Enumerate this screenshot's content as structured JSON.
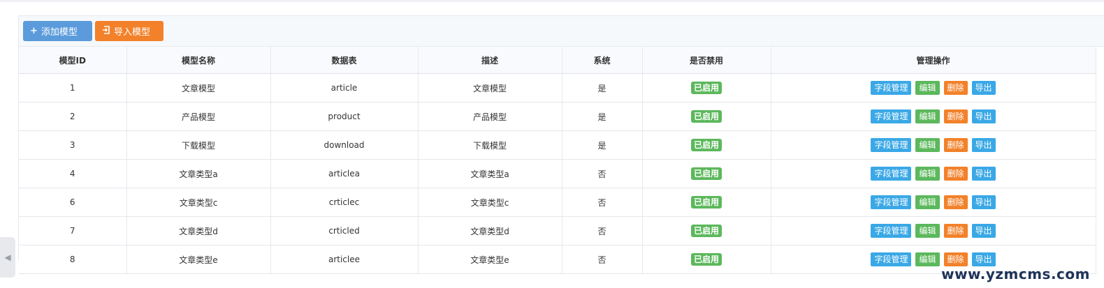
{
  "toolbar": {
    "add_label": "添加模型",
    "add_icon": "plus-icon",
    "import_label": "导入模型",
    "import_icon": "import-icon",
    "add_color": "#5b9bdc",
    "import_color": "#f2812a"
  },
  "table": {
    "headers": [
      "模型ID",
      "模型名称",
      "数据表",
      "描述",
      "系统",
      "是否禁用",
      "管理操作"
    ],
    "rows": [
      {
        "id": "1",
        "name": "文章模型",
        "table": "article",
        "desc": "文章模型",
        "system": "是",
        "status": "已启用"
      },
      {
        "id": "2",
        "name": "产品模型",
        "table": "product",
        "desc": "产品模型",
        "system": "是",
        "status": "已启用"
      },
      {
        "id": "3",
        "name": "下载模型",
        "table": "download",
        "desc": "下载模型",
        "system": "是",
        "status": "已启用"
      },
      {
        "id": "4",
        "name": "文章类型a",
        "table": "articlea",
        "desc": "文章类型a",
        "system": "否",
        "status": "已启用"
      },
      {
        "id": "6",
        "name": "文章类型c",
        "table": "crticlec",
        "desc": "文章类型c",
        "system": "否",
        "status": "已启用"
      },
      {
        "id": "7",
        "name": "文章类型d",
        "table": "crticled",
        "desc": "文章类型d",
        "system": "否",
        "status": "已启用"
      },
      {
        "id": "8",
        "name": "文章类型e",
        "table": "articlee",
        "desc": "文章类型e",
        "system": "否",
        "status": "已启用"
      }
    ],
    "actions": {
      "field": "字段管理",
      "edit": "编辑",
      "delete": "删除",
      "export": "导出"
    }
  },
  "colors": {
    "enabled_badge": "#5cb85c",
    "field_button": "#3aa8e6",
    "edit_button": "#5cb85c",
    "delete_button": "#f2812a",
    "export_button": "#3aa8e6"
  },
  "watermark": "www.yzmcms.com",
  "sidebar_toggle_icon": "chevron-left-icon"
}
